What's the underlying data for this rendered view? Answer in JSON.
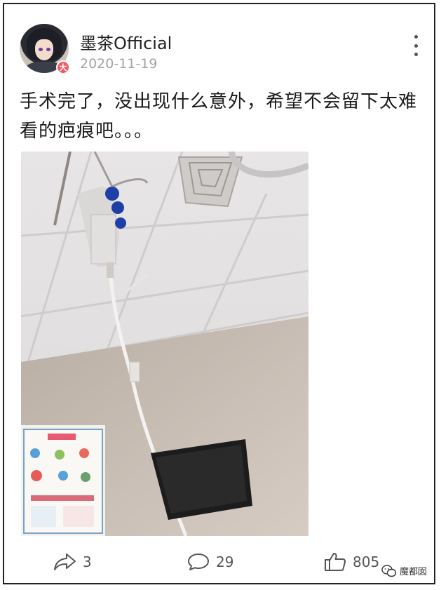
{
  "post": {
    "username": "墨茶Official",
    "date": "2020-11-19",
    "avatar_badge": "大",
    "text": "手术完了，没出现什么意外，希望不会留下太难看的疤痕吧。。。"
  },
  "actions": {
    "share_count": "3",
    "comment_count": "29",
    "like_count": "805"
  },
  "watermark": {
    "text": "魔都囡"
  },
  "icons": {
    "more": "more-vertical-icon",
    "share": "share-arrow-icon",
    "comment": "comment-bubble-icon",
    "like": "thumbs-up-icon",
    "wechat": "wechat-icon"
  },
  "colors": {
    "badge": "#f25a62",
    "date": "#a3a3a3",
    "infusion_clamp": "#1f3fa8"
  }
}
